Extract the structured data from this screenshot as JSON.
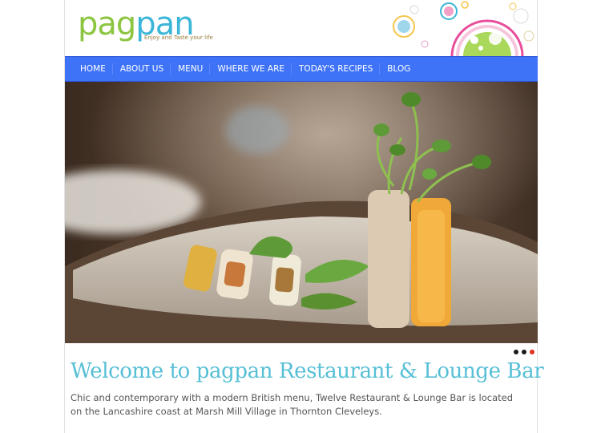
{
  "header": {
    "logo_part1": "pag",
    "logo_part2": "pan",
    "tagline": "Enjoy and Taste your life"
  },
  "nav": {
    "items": [
      {
        "label": "HOME"
      },
      {
        "label": "ABOUT US"
      },
      {
        "label": "MENU"
      },
      {
        "label": "WHERE WE ARE"
      },
      {
        "label": "TODAY'S RECIPES"
      },
      {
        "label": "BLOG"
      }
    ]
  },
  "slider": {
    "slide_count": 3,
    "active_index": 2
  },
  "content": {
    "heading": "Welcome to pagpan Restaurant & Lounge Bar",
    "intro": "Chic and contemporary with a modern British menu, Twelve Restaurant & Lounge Bar is located on the Lancashire coast at Marsh Mill Village in Thornton Cleveleys."
  },
  "colors": {
    "nav_bg": "#3f73f7",
    "logo_green": "#8cc540",
    "logo_blue": "#3bb6d8",
    "heading": "#56bfd6",
    "active_dot": "#e03020"
  }
}
